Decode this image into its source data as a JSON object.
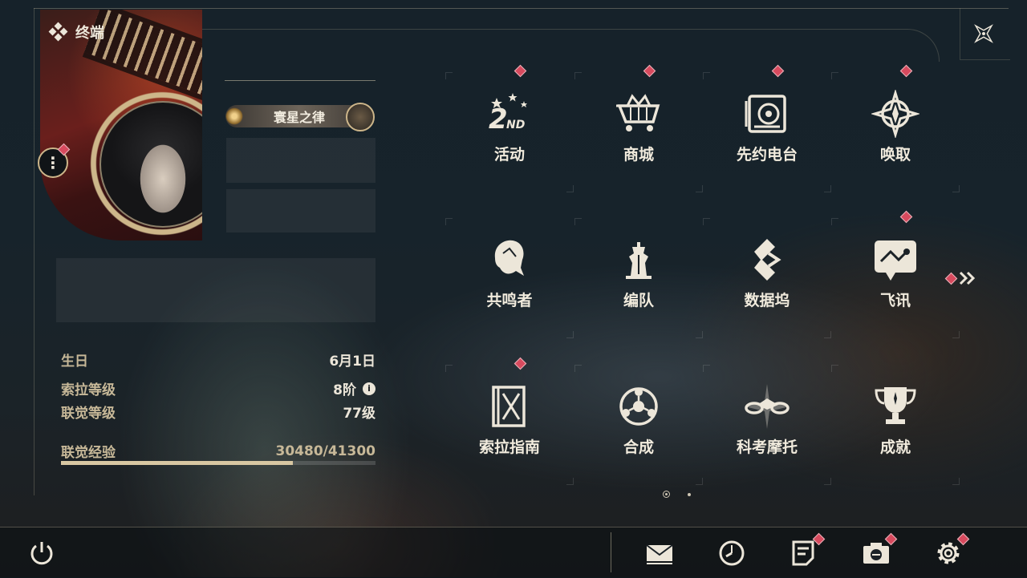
{
  "header": {
    "title": "终端"
  },
  "profile": {
    "title_plate": "寰星之律",
    "stats": [
      {
        "label": "生日",
        "value": "6月1日"
      },
      {
        "label": "索拉等级",
        "value": "8阶"
      },
      {
        "label": "联觉等级",
        "value": "77级"
      },
      {
        "label": "联觉经验",
        "value": "30480/41300"
      }
    ],
    "exp_current": 30480,
    "exp_max": 41300
  },
  "menu": {
    "items": [
      {
        "label": "活动",
        "icon": "2nd-anniversary-icon",
        "badge": true
      },
      {
        "label": "商城",
        "icon": "shop-cart-icon",
        "badge": true
      },
      {
        "label": "先约电台",
        "icon": "radio-icon",
        "badge": true
      },
      {
        "label": "唤取",
        "icon": "convene-star-icon",
        "badge": true
      },
      {
        "label": "共鸣者",
        "icon": "resonator-icon",
        "badge": false
      },
      {
        "label": "编队",
        "icon": "team-chess-icon",
        "badge": false
      },
      {
        "label": "数据坞",
        "icon": "data-bank-icon",
        "badge": false
      },
      {
        "label": "飞讯",
        "icon": "message-icon",
        "badge": true
      },
      {
        "label": "索拉指南",
        "icon": "guidebook-icon",
        "badge": true
      },
      {
        "label": "合成",
        "icon": "synthesis-icon",
        "badge": false
      },
      {
        "label": "科考摩托",
        "icon": "motorcycle-icon",
        "badge": false
      },
      {
        "label": "成就",
        "icon": "trophy-icon",
        "badge": false
      }
    ],
    "page_current": 1,
    "page_total": 2
  },
  "bottom_bar": {
    "items": [
      "power-icon",
      "mail-icon",
      "clock-icon",
      "notice-icon",
      "camera-icon",
      "settings-gear-icon"
    ]
  },
  "colors": {
    "accent": "#d8c7a2",
    "badge": "#d74a5e",
    "text": "#ece6d9"
  }
}
